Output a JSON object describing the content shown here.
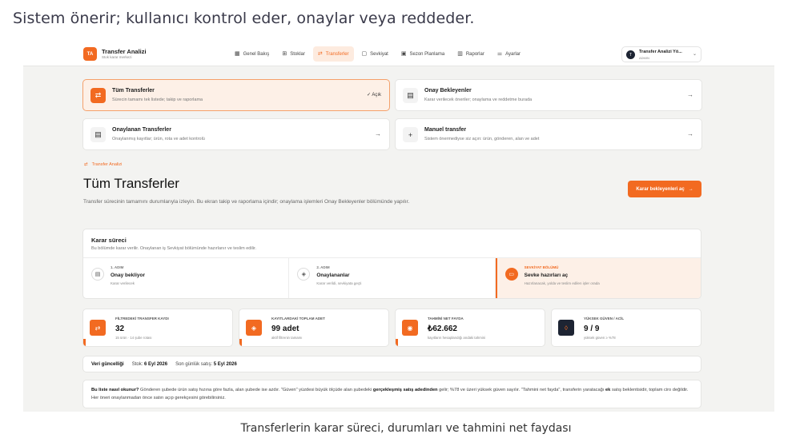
{
  "caption_top": "Sistem önerir; kullanıcı kontrol eder, onaylar veya reddeder.",
  "caption_bottom": "Transferlerin karar süreci, durumları ve tahmini net faydası",
  "brand": {
    "initials": "TA",
    "title": "Transfer Analizi",
    "subtitle": "Stok karar merkezi"
  },
  "nav": [
    {
      "label": "Genel Bakış",
      "icon": "grid-icon"
    },
    {
      "label": "Stoklar",
      "icon": "boxes-icon"
    },
    {
      "label": "Transferler",
      "icon": "transfer-icon",
      "active": true
    },
    {
      "label": "Sevkiyat",
      "icon": "clipboard-icon"
    },
    {
      "label": "Sezon Planlama",
      "icon": "calendar-icon"
    },
    {
      "label": "Raporlar",
      "icon": "bar-chart-icon"
    },
    {
      "label": "Ayarlar",
      "icon": "sliders-icon"
    }
  ],
  "user": {
    "initial": "T",
    "name": "Transfer Analizi Yö...",
    "role": "ADMIN"
  },
  "options": [
    {
      "title": "Tüm Transferler",
      "desc": "Sürecin tamamı tek listede; takip ve raporlama",
      "status": "✓ Açık",
      "selected": true
    },
    {
      "title": "Onay Bekleyenler",
      "desc": "Karar verilecek öneriler; onaylama ve reddetme burada",
      "status": "→"
    },
    {
      "title": "Onaylanan Transferler",
      "desc": "Onaylanmış kayıtlar; ürün, rota ve adet kontrolü",
      "status": "→"
    },
    {
      "title": "Manuel transfer",
      "desc": "Sistem önermediyse siz açın: ürün, gönderen, alan ve adet",
      "status": "→"
    }
  ],
  "page": {
    "eyebrow": "Transfer Analizi",
    "title": "Tüm Transferler",
    "lead": "Transfer sürecinin tamamını durumlarıyla izleyin. Bu ekran takip ve raporlama içindir; onaylama işlemleri Onay Bekleyenler bölümünde yapılır.",
    "cta": "Karar bekleyenleri aç"
  },
  "decision": {
    "title": "Karar süreci",
    "subtitle": "Bu bölümde karar verilir. Onaylanan iş Sevkiyat bölümünde hazırlanır ve teslim edilir.",
    "steps": [
      {
        "no": "1. ADIM",
        "name": "Onay bekliyor",
        "desc": "Karar verilecek"
      },
      {
        "no": "2. ADIM",
        "name": "Onaylananlar",
        "desc": "Karar verildi, sevkiyata geçti"
      },
      {
        "no": "SEVKİYAT BÖLÜMÜ",
        "name": "Sevke hazırları aç",
        "desc": "Hazırlanacak, yolda ve teslim edilen işler orada",
        "current": true
      }
    ]
  },
  "stats": [
    {
      "label": "FİLTREDEKİ TRANSFER KAYDI",
      "value": "32",
      "note": "15 ürün · 14 şube rotası"
    },
    {
      "label": "KAYITLARDAKİ TOPLAM ADET",
      "value": "99 adet",
      "note": "aktif filtrenin tamamı"
    },
    {
      "label": "TAHMİNİ NET FAYDA",
      "value": "₺62.662",
      "note": "kayıtların hesaplandığı andaki tahmini"
    },
    {
      "label": "YÜKSEK GÜVEN / ACİL",
      "value": "9 / 9",
      "note": "yüksek güven ≥ %78"
    }
  ],
  "data_line": {
    "label": "Veri güncelliği",
    "stock_label": "Stok:",
    "stock_date": "6 Eyl 2026",
    "sale_label": "Son günlük satış:",
    "sale_date": "5 Eyl 2026"
  },
  "note": {
    "lead": "Bu liste nasıl okunur?",
    "p1": "Gönderen şubede ürün satış hızına göre fazla, alan şubede ise azdır. \"Güven\" yüzdesi büyük ölçüde alan şubedeki",
    "b1": "gerçekleşmiş satış adedinden",
    "p2": "gelir; %78 ve üzeri yüksek güven sayılır. \"Tahmini net fayda\", transferin yaratacağı",
    "b2": "ek",
    "p3": "satış beklentisidir, toplam ciro değildir. Her öneri onaylanmadan önce satırı açıp gerekçesini görebilirsiniz."
  },
  "colors": {
    "accent": "#f26a21",
    "accent_soft": "#fdf0e7",
    "dark": "#1d2433"
  }
}
